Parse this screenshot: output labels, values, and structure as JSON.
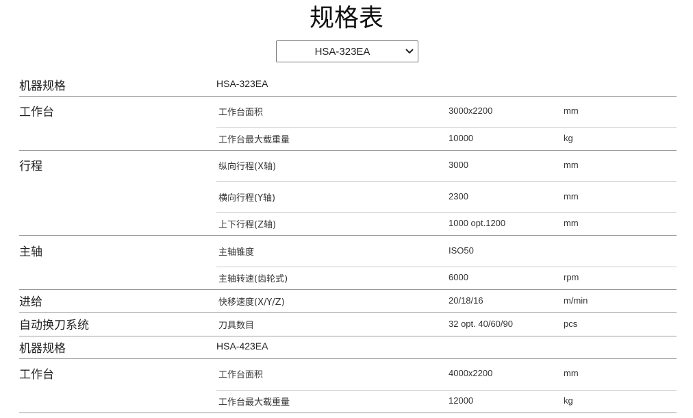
{
  "page_title": "规格表",
  "model_select": {
    "selected": "HSA-323EA"
  },
  "specs": [
    {
      "model_label": "机器规格",
      "model": "HSA-323EA",
      "groups": [
        {
          "name": "工作台",
          "rows": [
            {
              "item": "工作台面积",
              "value": "3000x2200",
              "unit": "mm"
            },
            {
              "item": "工作台最大载重量",
              "value": "10000",
              "unit": "kg"
            }
          ]
        },
        {
          "name": "行程",
          "rows": [
            {
              "item": "纵向行程(X轴)",
              "value": "3000",
              "unit": "mm"
            },
            {
              "item": "横向行程(Y轴)",
              "value": "2300",
              "unit": "mm"
            },
            {
              "item": "上下行程(Z轴)",
              "value": "1000 opt.1200",
              "unit": "mm"
            }
          ]
        },
        {
          "name": "主轴",
          "rows": [
            {
              "item": "主轴锥度",
              "value": "ISO50",
              "unit": ""
            },
            {
              "item": "主轴转速(齿轮式)",
              "value": "6000",
              "unit": "rpm"
            }
          ]
        },
        {
          "name": "进给",
          "rows": [
            {
              "item": "快移速度(X/Y/Z)",
              "value": "20/18/16",
              "unit": "m/min"
            }
          ]
        },
        {
          "name": "自动换刀系统",
          "rows": [
            {
              "item": "刀具数目",
              "value": "32 opt. 40/60/90",
              "unit": "pcs"
            }
          ]
        }
      ]
    },
    {
      "model_label": "机器规格",
      "model": "HSA-423EA",
      "groups": [
        {
          "name": "工作台",
          "rows": [
            {
              "item": "工作台面积",
              "value": "4000x2200",
              "unit": "mm"
            },
            {
              "item": "工作台最大载重量",
              "value": "12000",
              "unit": "kg"
            }
          ]
        }
      ]
    }
  ]
}
